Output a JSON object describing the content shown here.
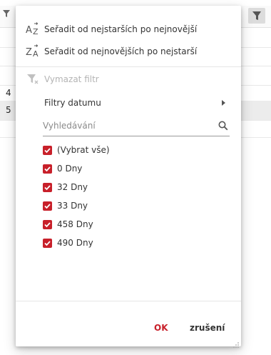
{
  "background": {
    "row_numbers": [
      "4",
      "5"
    ]
  },
  "menu": {
    "sort_asc_label": "Seřadit od nejstarších po nejnovější",
    "sort_desc_label": "Seřadit od nejnovějších po nejstarší",
    "sort_asc_icon": "sort-az-icon",
    "sort_desc_icon": "sort-za-icon",
    "clear_filter_label": "Vymazat filtr",
    "clear_filter_icon": "clear-filter-icon",
    "date_filters_label": "Filtry datumu",
    "search_placeholder": "Vyhledávání",
    "search_icon": "search-icon"
  },
  "checklist": [
    {
      "label": "(Vybrat vše)",
      "checked": true
    },
    {
      "label": "0 Dny",
      "checked": true
    },
    {
      "label": "32 Dny",
      "checked": true
    },
    {
      "label": "33 Dny",
      "checked": true
    },
    {
      "label": "458 Dny",
      "checked": true
    },
    {
      "label": "490 Dny",
      "checked": true
    }
  ],
  "footer": {
    "ok_label": "OK",
    "cancel_label": "zrušení"
  },
  "colors": {
    "accent": "#c8202a",
    "disabled_text": "#b4b4b4"
  }
}
